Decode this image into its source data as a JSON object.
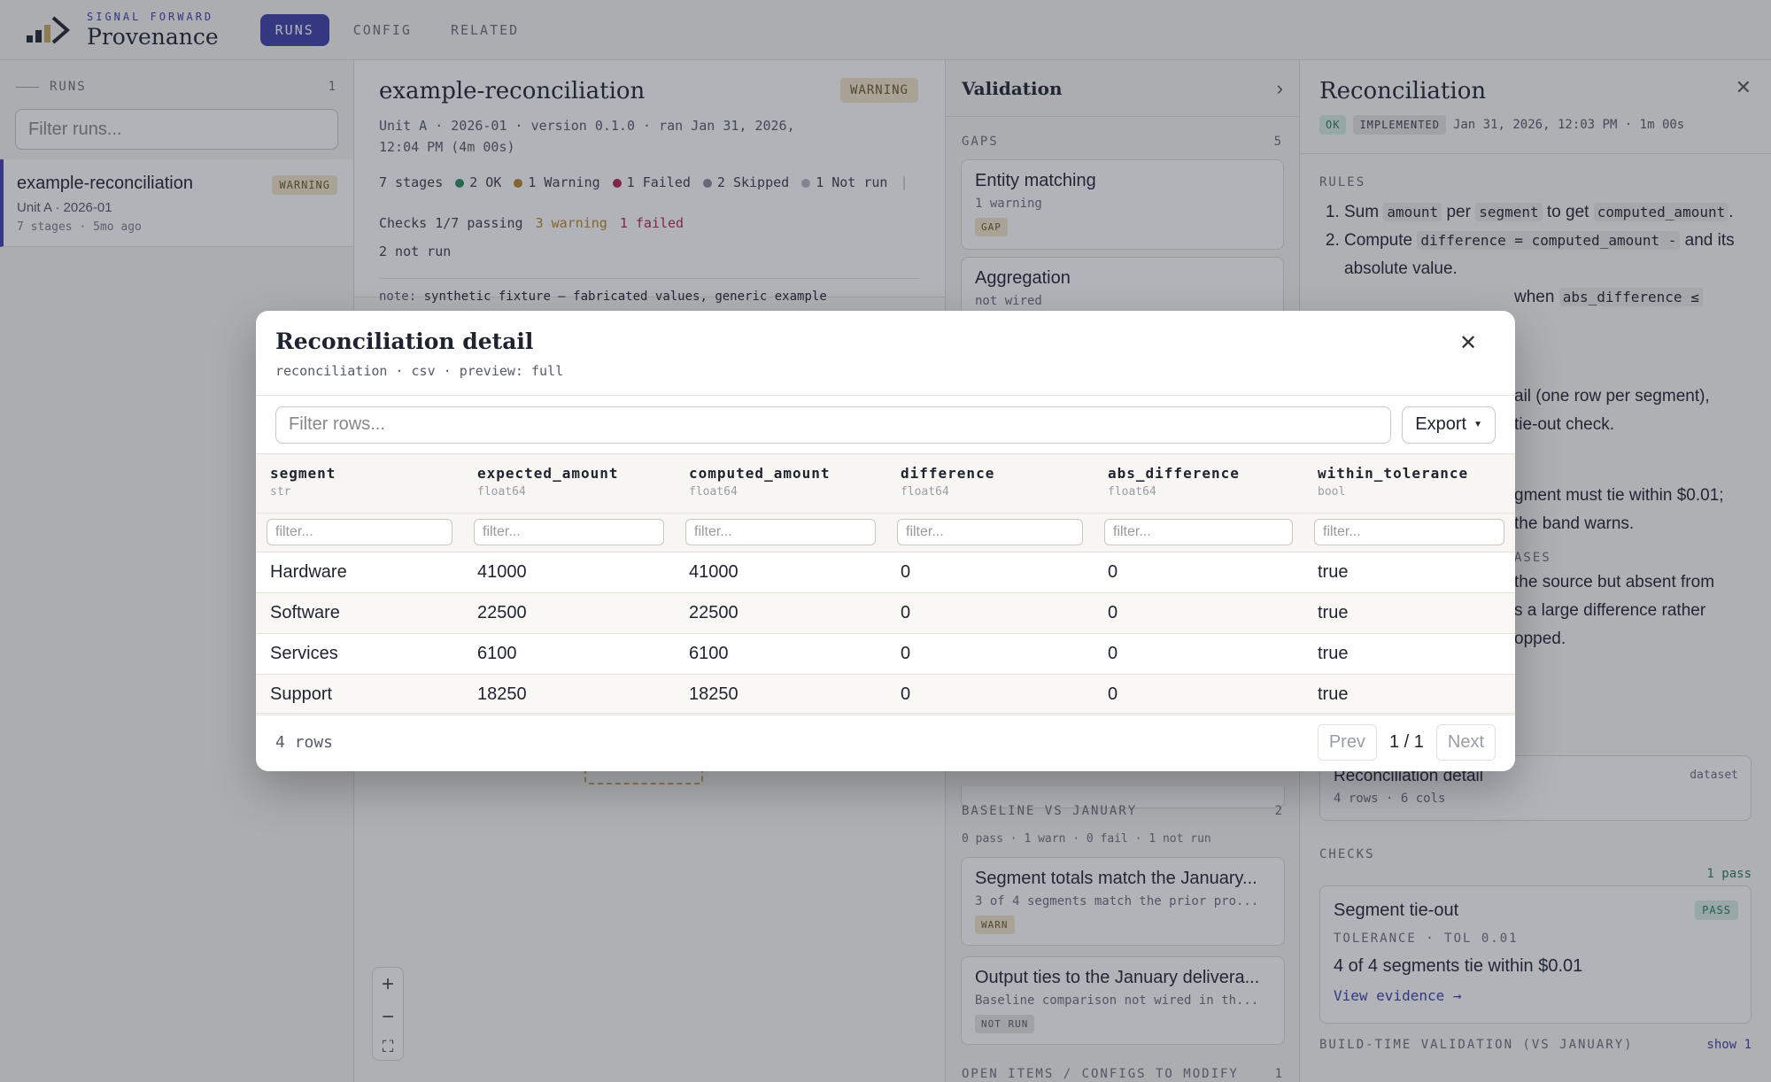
{
  "app": {
    "brand_sub": "SIGNAL FORWARD",
    "brand_name": "Provenance",
    "nav": [
      {
        "label": "RUNS",
        "active": true
      },
      {
        "label": "CONFIG",
        "active": false
      },
      {
        "label": "RELATED",
        "active": false
      }
    ]
  },
  "runs": {
    "label": "RUNS",
    "count": "1",
    "filter_placeholder": "Filter runs...",
    "items": [
      {
        "title": "example-reconciliation",
        "meta": "Unit A · 2026-01",
        "meta2": "7 stages · 5mo ago",
        "status": "WARNING"
      }
    ]
  },
  "detail": {
    "title": "example-reconciliation",
    "status": "WARNING",
    "meta": "Unit A · 2026-01 · version 0.1.0 · ran Jan 31, 2026, 12:04 PM (4m 00s)",
    "stages": "7 stages",
    "ok": "2 OK",
    "warning": "1 Warning",
    "failed": "1 Failed",
    "skipped": "2 Skipped",
    "not_run": "1 Not run",
    "checks": "Checks 1/7 passing",
    "checks_warning": "3 warning",
    "checks_failed": "1 failed",
    "checks_not_run": "2 not run",
    "note_label": "note:",
    "note_text": "synthetic fixture — fabricated values, generic example",
    "colors": {
      "ok": "#2c8a5e",
      "warning": "#b8862b",
      "failed": "#b0244e",
      "skipped": "#8a8d96",
      "not_run": "#b5b7be"
    }
  },
  "validation": {
    "title": "Validation",
    "gaps_label": "GAPS",
    "gaps_count": "5",
    "gaps": [
      {
        "title": "Entity matching",
        "sub": "1 warning",
        "tag": "GAP"
      },
      {
        "title": "Aggregation",
        "sub": "not wired",
        "tag": ""
      }
    ],
    "baseline_label": "BASELINE VS JANUARY",
    "baseline_count": "2",
    "baseline_summary": "0 pass · 1 warn · 0 fail · 1 not run",
    "baseline": [
      {
        "title": "Segment totals match the January...",
        "sub": "3 of 4 segments match the prior pro...",
        "tag": "WARN"
      },
      {
        "title": "Output ties to the January delivera...",
        "sub": "Baseline comparison not wired in th...",
        "tag": "NOT RUN"
      }
    ],
    "open_label": "OPEN ITEMS / CONFIGS TO MODIFY",
    "open_count": "1"
  },
  "reconciliation": {
    "title": "Reconciliation",
    "tag_ok": "OK",
    "tag_impl": "IMPLEMENTED",
    "meta": "Jan 31, 2026, 12:03 PM · 1m 00s",
    "rules_label": "RULES",
    "rule1_a": "Sum",
    "rule1_code1": "amount",
    "rule1_b": "per",
    "rule1_code2": "segment",
    "rule1_c": "to get",
    "rule1_code3": "computed_amount",
    "rule2_a": "Compute",
    "rule2_code1": "difference = computed_amount -",
    "rule2_b": "and its absolute value.",
    "rule3_a": "when",
    "rule3_code": "abs_difference ≤",
    "para1": "ail (one row per segment),",
    "para2": "tie-out check.",
    "para3": "gment must tie within $0.01;",
    "para4": "the band warns.",
    "cases_label": "ASES",
    "para5": "the source but absent from",
    "para6": "s a large difference rather",
    "para7": "opped.",
    "dataset": {
      "title": "Reconciliation detail",
      "sub": "4 rows · 6 cols",
      "kind": "dataset"
    },
    "checks_label": "CHECKS",
    "checks_pass": "1 pass",
    "check": {
      "title": "Segment tie-out",
      "status": "PASS",
      "tolerance": "TOLERANCE · TOL 0.01",
      "result": "4 of 4 segments tie within $0.01",
      "link": "View evidence →"
    },
    "build_label": "BUILD-TIME VALIDATION (VS JANUARY)",
    "build_show": "show 1"
  },
  "modal": {
    "title": "Reconciliation detail",
    "subtitle": "reconciliation · csv · preview: full",
    "filter_placeholder": "Filter rows...",
    "export_label": "Export",
    "column_filter_placeholder": "filter...",
    "columns": [
      {
        "name": "segment",
        "type": "str"
      },
      {
        "name": "expected_amount",
        "type": "float64"
      },
      {
        "name": "computed_amount",
        "type": "float64"
      },
      {
        "name": "difference",
        "type": "float64"
      },
      {
        "name": "abs_difference",
        "type": "float64"
      },
      {
        "name": "within_tolerance",
        "type": "bool"
      }
    ],
    "rows": [
      [
        "Hardware",
        "41000",
        "41000",
        "0",
        "0",
        "true"
      ],
      [
        "Software",
        "22500",
        "22500",
        "0",
        "0",
        "true"
      ],
      [
        "Services",
        "6100",
        "6100",
        "0",
        "0",
        "true"
      ],
      [
        "Support",
        "18250",
        "18250",
        "0",
        "0",
        "true"
      ]
    ],
    "row_count": "4 rows",
    "prev_label": "Prev",
    "next_label": "Next",
    "page_current": "1",
    "page_sep": "/",
    "page_total": "1"
  }
}
